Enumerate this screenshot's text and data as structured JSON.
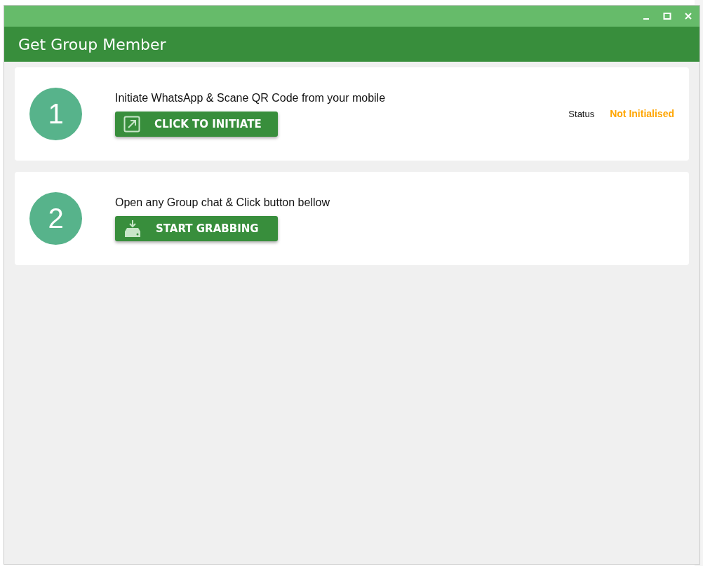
{
  "window": {
    "title": "Get Group Member"
  },
  "steps": [
    {
      "number": "1",
      "instruction": "Initiate WhatsApp & Scane QR Code from your mobile",
      "button": {
        "label": "CLICK TO INITIATE",
        "kind": "open"
      },
      "status": {
        "label": "Status",
        "value": "Not Initialised"
      }
    },
    {
      "number": "2",
      "instruction": "Open any Group chat & Click button bellow",
      "button": {
        "label": "START GRABBING",
        "kind": "download"
      }
    }
  ]
}
